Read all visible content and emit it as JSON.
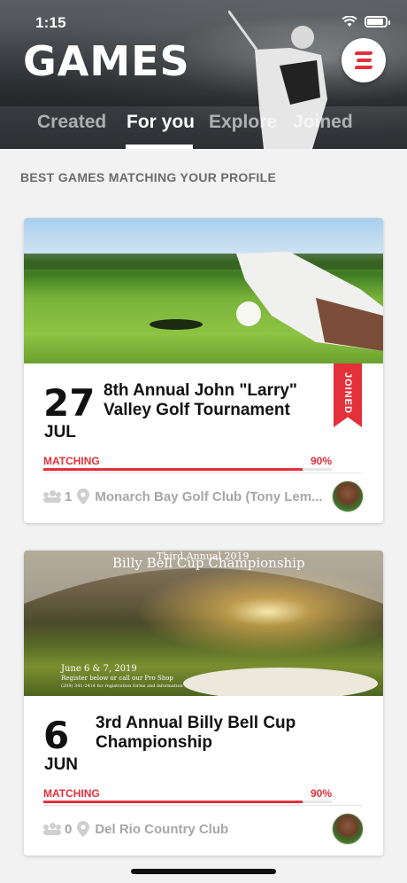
{
  "status_bar": {
    "time": "1:15"
  },
  "header": {
    "title": "GAMES",
    "menu_icon": "hamburger-menu-icon",
    "tabs": [
      {
        "label": "Created",
        "active": false
      },
      {
        "label": "For you",
        "active": true
      },
      {
        "label": "Explore",
        "active": false
      },
      {
        "label": "Joined",
        "active": false
      }
    ]
  },
  "section_heading": "BEST GAMES MATCHING YOUR PROFILE",
  "games": [
    {
      "day": "27",
      "month": "JUL",
      "title": "8th Annual John \"Larry\" Valley Golf Tournament",
      "ribbon": "JOINED",
      "matching_label": "MATCHING",
      "matching_value": "90%",
      "matching_fraction": 0.9,
      "participants": "1",
      "venue": "Monarch Bay Golf Club (Tony Lem..."
    },
    {
      "day": "6",
      "month": "JUN",
      "title": "3rd Annual Billy Bell Cup Championship",
      "image_text": {
        "top_small": "Third Annual  2019",
        "headline": "Billy Bell Cup Championship",
        "line1": "June 6 & 7, 2019",
        "line2": "Register below or call our Pro Shop",
        "line3": "(209) 341-2414 for registration forms and information"
      },
      "matching_label": "MATCHING",
      "matching_value": "90%",
      "matching_fraction": 0.9,
      "participants": "0",
      "venue": "Del Rio Country Club"
    }
  ],
  "colors": {
    "accent": "#e3303b",
    "muted": "#a7a7a7"
  }
}
